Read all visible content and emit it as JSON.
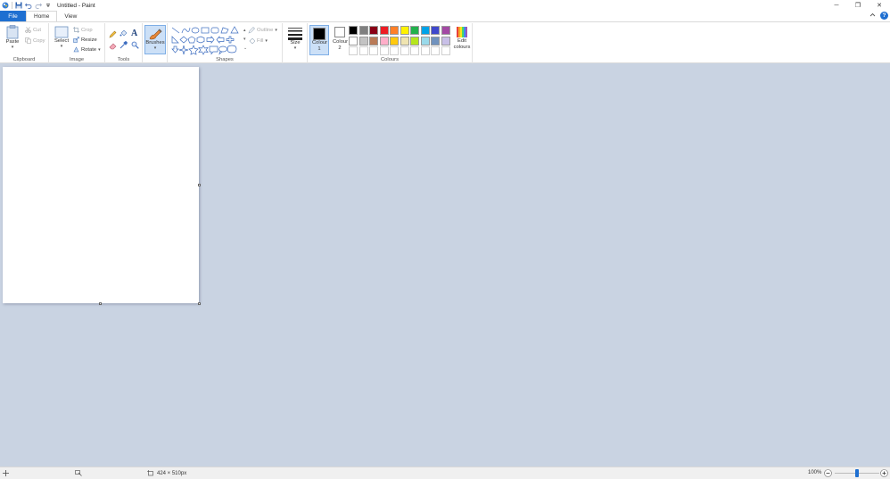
{
  "window": {
    "title": "Untitled - Paint",
    "controls": {
      "minimize": "─",
      "maximize": "❐",
      "close": "✕"
    }
  },
  "tabs": {
    "file": "File",
    "home": "Home",
    "view": "View",
    "help": "?"
  },
  "clipboard": {
    "paste": "Paste",
    "cut": "Cut",
    "copy": "Copy",
    "label": "Clipboard"
  },
  "image": {
    "select": "Select",
    "crop": "Crop",
    "resize": "Resize",
    "rotate": "Rotate",
    "label": "Image"
  },
  "tools": {
    "label": "Tools",
    "text_tool": "A"
  },
  "brushes": {
    "label": "Brushes"
  },
  "shapes": {
    "outline": "Outline",
    "fill": "Fill",
    "label": "Shapes"
  },
  "size": {
    "label": "Size"
  },
  "colours": {
    "colour1_label": "Colour 1",
    "colour2_label": "Colour 2",
    "colour1_value": "#000000",
    "colour2_value": "#ffffff",
    "edit_label": "Edit colours",
    "label": "Colours",
    "palette_row1": [
      "#000000",
      "#7f7f7f",
      "#880015",
      "#ed1c24",
      "#ff7f27",
      "#fff200",
      "#22b14c",
      "#00a2e8",
      "#3f48cc",
      "#a349a4"
    ],
    "palette_row2": [
      "#ffffff",
      "#c3c3c3",
      "#b97a57",
      "#ffaec9",
      "#ffc90e",
      "#efe4b0",
      "#b5e61d",
      "#99d9ea",
      "#7092be",
      "#c8bfe7"
    ]
  },
  "status": {
    "canvas_size": "424 × 510px",
    "zoom": "100%",
    "zoom_level": 1.0
  }
}
